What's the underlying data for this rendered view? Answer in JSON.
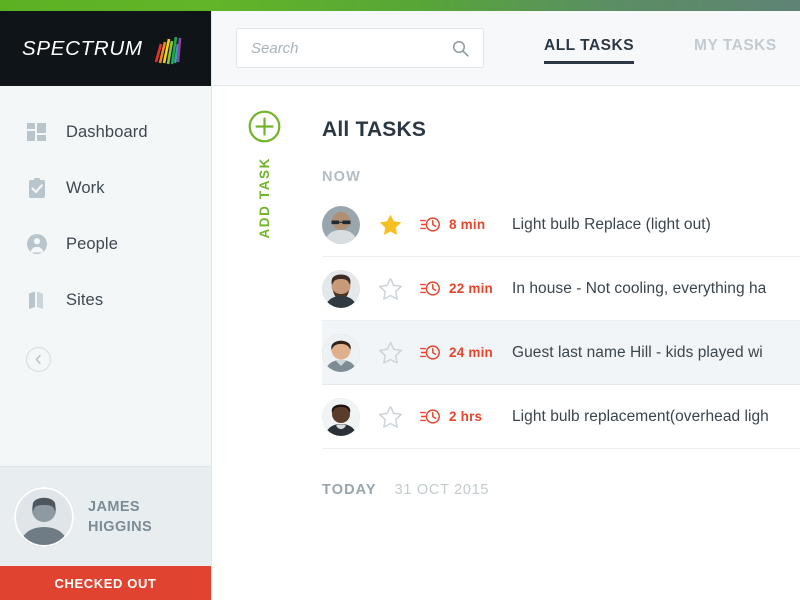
{
  "brand": {
    "name": "SPECTRUM",
    "logo_icon": "spectrum-bars-icon",
    "logo_colors": [
      "#e2342b",
      "#f08a1e",
      "#f3d319",
      "#8cc63f",
      "#1fa84f",
      "#2ca6a0",
      "#8e44ad"
    ]
  },
  "topbar": {
    "gradient_from": "#5ab223",
    "gradient_to": "#5f8375"
  },
  "sidebar": {
    "items": [
      {
        "label": "Dashboard",
        "icon": "grid-icon"
      },
      {
        "label": "Work",
        "icon": "clipboard-check-icon"
      },
      {
        "label": "People",
        "icon": "person-icon"
      },
      {
        "label": "Sites",
        "icon": "map-icon"
      }
    ],
    "collapse_icon": "chevron-left-icon",
    "user": {
      "name_line1": "JAMES",
      "name_line2": "HIGGINS",
      "avatar_icon": "user-avatar",
      "status_label": "CHECKED OUT",
      "status_color": "#e04430"
    }
  },
  "header": {
    "search": {
      "placeholder": "Search",
      "value": "",
      "icon": "search-icon"
    },
    "tabs": [
      {
        "label": "ALL TASKS",
        "active": true
      },
      {
        "label": "MY TASKS",
        "active": false
      }
    ]
  },
  "main": {
    "add_task": {
      "label": "ADD TASK",
      "icon": "plus-circle-icon",
      "color": "#72b42a"
    },
    "page_title": "All TASKS",
    "sections": [
      {
        "label": "NOW",
        "date": ""
      },
      {
        "label": "TODAY",
        "date": "31 OCT 2015"
      }
    ],
    "tasks": [
      {
        "avatar": "avatar-man-sunglasses",
        "starred": true,
        "star_icon": "star-filled-icon",
        "clock_icon": "clock-urgent-icon",
        "time": "8 min",
        "title": "Light bulb Replace (light out)",
        "highlighted": false
      },
      {
        "avatar": "avatar-man-beard",
        "starred": false,
        "star_icon": "star-outline-icon",
        "clock_icon": "clock-urgent-icon",
        "time": "22 min",
        "title": "In house - Not cooling, everything ha",
        "highlighted": false
      },
      {
        "avatar": "avatar-man-smiling",
        "starred": false,
        "star_icon": "star-outline-icon",
        "clock_icon": "clock-urgent-icon",
        "time": "24 min",
        "title": "Guest last name Hill - kids played wi",
        "highlighted": true
      },
      {
        "avatar": "avatar-man-dark",
        "starred": false,
        "star_icon": "star-outline-icon",
        "clock_icon": "clock-urgent-icon",
        "time": "2 hrs",
        "title": "Light bulb replacement(overhead ligh",
        "highlighted": false
      }
    ]
  },
  "colors": {
    "accent_green": "#72b42a",
    "urgent_red": "#e8452c",
    "star_gold": "#f5c020",
    "dark_navy": "#2b3742",
    "sidebar_bg": "#f4f7f8"
  }
}
